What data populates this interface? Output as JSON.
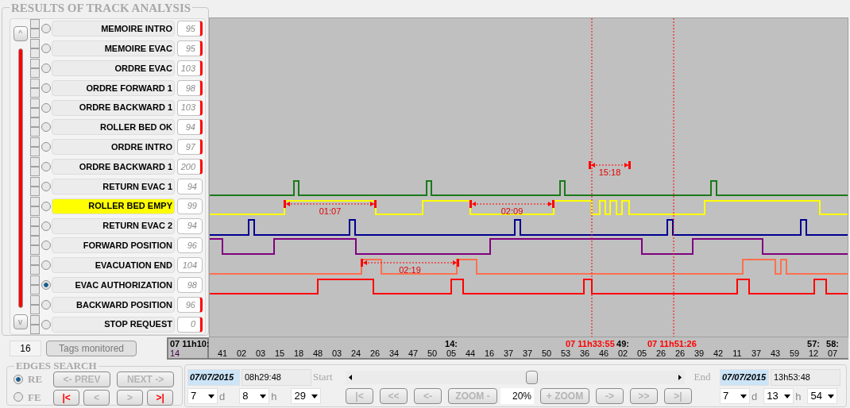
{
  "panel": {
    "title": "RESULTS OF TRACK ANALYSIS",
    "scroll_up": "^",
    "scroll_down": "v"
  },
  "signals": [
    {
      "name": "MEMOIRE INTRO",
      "checked": false,
      "value": "95",
      "selected": false,
      "highlighted": false,
      "marked": true
    },
    {
      "name": "MEMOIRE EVAC",
      "checked": false,
      "value": "95",
      "selected": false,
      "highlighted": false,
      "marked": true
    },
    {
      "name": "ORDRE EVAC",
      "checked": false,
      "value": "103",
      "selected": false,
      "highlighted": false,
      "marked": true
    },
    {
      "name": "ORDRE FORWARD 1",
      "checked": false,
      "value": "98",
      "selected": false,
      "highlighted": false,
      "marked": true
    },
    {
      "name": "ORDRE BACKWARD 1",
      "checked": false,
      "value": "103",
      "selected": false,
      "highlighted": false,
      "marked": true
    },
    {
      "name": "ROLLER BED OK",
      "checked": false,
      "value": "94",
      "selected": false,
      "highlighted": false,
      "marked": true
    },
    {
      "name": "ORDRE INTRO",
      "checked": false,
      "value": "97",
      "selected": false,
      "highlighted": false,
      "marked": true
    },
    {
      "name": "ORDRE BACKWARD 1",
      "checked": false,
      "value": "200",
      "selected": false,
      "highlighted": false,
      "marked": true
    },
    {
      "name": "RETURN EVAC 1",
      "checked": false,
      "value": "94",
      "selected": false,
      "highlighted": false,
      "marked": false
    },
    {
      "name": "ROLLER BED EMPY",
      "checked": false,
      "value": "99",
      "selected": false,
      "highlighted": true,
      "marked": false
    },
    {
      "name": "RETURN EVAC 2",
      "checked": false,
      "value": "94",
      "selected": false,
      "highlighted": false,
      "marked": false
    },
    {
      "name": "FORWARD POSITION",
      "checked": false,
      "value": "96",
      "selected": false,
      "highlighted": false,
      "marked": false
    },
    {
      "name": "EVACUATION END",
      "checked": false,
      "value": "104",
      "selected": false,
      "highlighted": false,
      "marked": false
    },
    {
      "name": "EVAC AUTHORIZATION",
      "checked": false,
      "value": "98",
      "selected": true,
      "highlighted": false,
      "marked": false
    },
    {
      "name": "BACKWARD POSITION",
      "checked": false,
      "value": "96",
      "selected": false,
      "highlighted": false,
      "marked": true
    },
    {
      "name": "STOP REQUEST",
      "checked": false,
      "value": "0",
      "selected": false,
      "highlighted": false,
      "marked": true
    }
  ],
  "tags": {
    "count": "16",
    "button": "Tags monitored"
  },
  "chart": {
    "traces": [
      {
        "color": "#1a7a1a"
      },
      {
        "color": "#ffff00"
      },
      {
        "color": "#000090"
      },
      {
        "color": "#800080"
      },
      {
        "color": "#ff7050"
      },
      {
        "color": "#ff0000"
      }
    ],
    "measurements": [
      {
        "label": "01:07"
      },
      {
        "label": "02:09"
      },
      {
        "label": "15:18"
      },
      {
        "label": "02:19"
      }
    ],
    "cursors": [
      {
        "label": "07 11h33:55"
      },
      {
        "label": "07 11h51:26"
      }
    ]
  },
  "axis": {
    "start_top": "07 11h10:",
    "start_label": "14",
    "ticks": [
      {
        "label": "41"
      },
      {
        "label": "02"
      },
      {
        "label": "03"
      },
      {
        "label": "15"
      },
      {
        "label": "18"
      },
      {
        "label": "48"
      },
      {
        "label": "03"
      },
      {
        "label": "24"
      },
      {
        "label": "26"
      },
      {
        "label": "34"
      },
      {
        "label": "47"
      },
      {
        "label": "50"
      },
      {
        "label": "05",
        "top": "14:"
      },
      {
        "label": "44"
      },
      {
        "label": "16"
      },
      {
        "label": "37"
      },
      {
        "label": "37"
      },
      {
        "label": "50"
      },
      {
        "label": "53"
      },
      {
        "label": "36"
      },
      {
        "label": "46"
      },
      {
        "label": "02",
        "top": "49:"
      },
      {
        "label": "05"
      },
      {
        "label": "26"
      },
      {
        "label": "26"
      },
      {
        "label": "39"
      },
      {
        "label": "42"
      },
      {
        "label": "11"
      },
      {
        "label": "37"
      },
      {
        "label": "43"
      },
      {
        "label": "59"
      },
      {
        "label": "12",
        "top": "57:"
      },
      {
        "label": "07",
        "top": "58:"
      }
    ]
  },
  "edges_search": {
    "title": "EDGES SEARCH",
    "modes": [
      {
        "label": "RE",
        "selected": true
      },
      {
        "label": "FE",
        "selected": false
      }
    ],
    "buttons": [
      {
        "label": "<- PREV",
        "disabled": true
      },
      {
        "label": "NEXT ->",
        "disabled": true
      },
      {
        "label": "|<",
        "disabled": false
      },
      {
        "label": "<",
        "disabled": true
      },
      {
        "label": ">",
        "disabled": true
      },
      {
        "label": ">|",
        "disabled": false
      }
    ]
  },
  "range": {
    "start_label": "Start",
    "start_date": "07/07/2015",
    "start_time": "08h29:48",
    "end_label": "End",
    "end_date": "07/07/2015",
    "end_time": "13h53:48",
    "level": 0.55,
    "start_selects": [
      {
        "value": "7",
        "unit": "d"
      },
      {
        "value": "8",
        "unit": "h"
      },
      {
        "value": "29"
      }
    ],
    "end_selects": [
      {
        "value": "7",
        "unit": "d"
      },
      {
        "value": "13",
        "unit": "h"
      },
      {
        "value": "54"
      }
    ],
    "nav_left": [
      {
        "label": "|<",
        "disabled": true
      },
      {
        "label": "<<",
        "disabled": true
      },
      {
        "label": "<-",
        "disabled": true
      },
      {
        "label": "ZOOM -",
        "disabled": true
      }
    ],
    "zoom": "20%",
    "nav_right": [
      {
        "label": "+ ZOOM",
        "disabled": true
      },
      {
        "label": "->",
        "disabled": true
      },
      {
        "label": ">>",
        "disabled": true
      },
      {
        "label": ">|",
        "disabled": true
      }
    ]
  }
}
